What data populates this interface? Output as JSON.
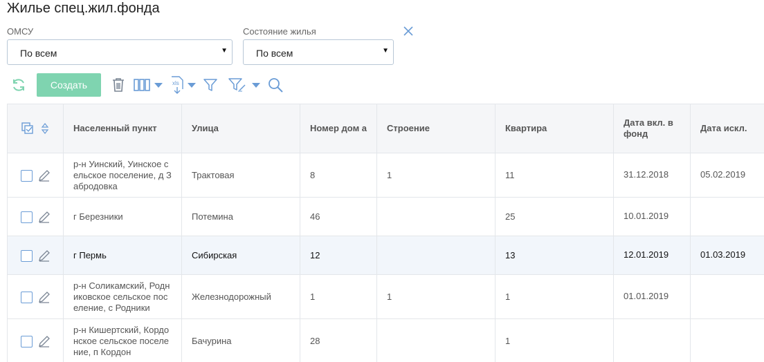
{
  "page": {
    "title": "Жилье спец.жил.фонда"
  },
  "filters": {
    "omsu": {
      "label": "ОМСУ",
      "value": "По всем"
    },
    "state": {
      "label": "Состояние жилья",
      "value": "По всем"
    }
  },
  "toolbar": {
    "create_label": "Создать",
    "icons": [
      "refresh-icon",
      "trash-icon",
      "columns-icon",
      "xls-export-icon",
      "filter-icon",
      "filter-edit-icon",
      "search-icon"
    ]
  },
  "colors": {
    "accent": "#6a9cd6",
    "create_button": "#7fd4b0",
    "refresh": "#7fd4b0"
  },
  "table": {
    "columns": [
      "Населенный пункт",
      "Улица",
      "Номер дом а",
      "Строение",
      "Квартира",
      "Дата вкл. в фонд",
      "Дата искл."
    ],
    "rows": [
      {
        "settlement": "р-н Уинский, Уинское с ельское поселение, д З абродовка",
        "street": "Трактовая",
        "house": "8",
        "building": "1",
        "apartment": "11",
        "date_in": "31.12.2018",
        "date_out": "05.02.2019"
      },
      {
        "settlement": "г Березники",
        "street": "Потемина",
        "house": "46",
        "building": "",
        "apartment": "25",
        "date_in": "10.01.2019",
        "date_out": ""
      },
      {
        "settlement": "г Пермь",
        "street": "Сибирская",
        "house": "12",
        "building": "",
        "apartment": "13",
        "date_in": "12.01.2019",
        "date_out": "01.03.2019"
      },
      {
        "settlement": "р-н Соликамский, Родн иковское сельское пос еление, с Родники",
        "street": "Железнодорожный",
        "house": "1",
        "building": "1",
        "apartment": "1",
        "date_in": "01.01.2019",
        "date_out": ""
      },
      {
        "settlement": "р-н Кишертский, Кордо нское сельское поселе ние, п Кордон",
        "street": "Бачурина",
        "house": "28",
        "building": "",
        "apartment": "1",
        "date_in": "",
        "date_out": ""
      }
    ]
  }
}
